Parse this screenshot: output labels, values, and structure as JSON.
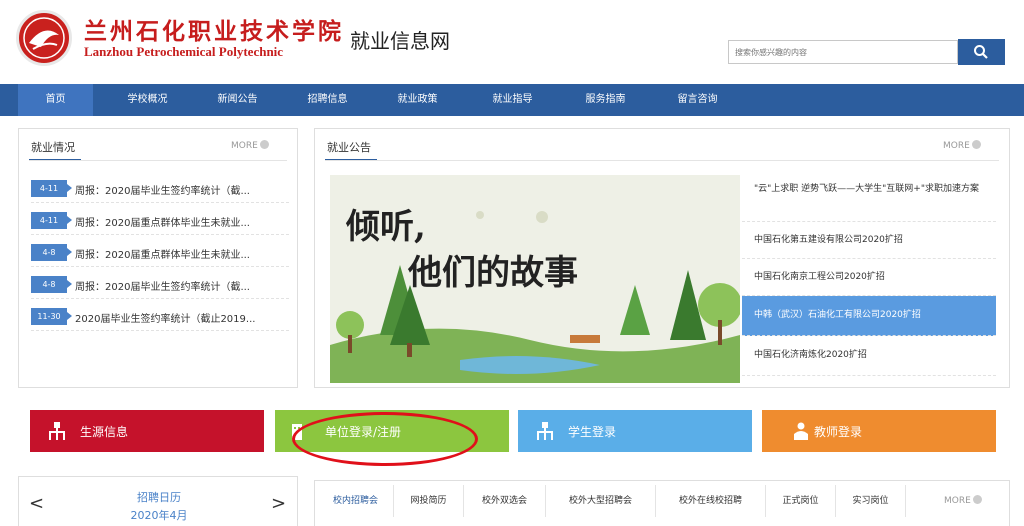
{
  "header": {
    "logo_cn": "兰州石化职业技术学院",
    "logo_en": "Lanzhou Petrochemical Polytechnic",
    "site_title": "就业信息网",
    "search_placeholder": "搜索你感兴趣的内容",
    "search_icon": "search-icon"
  },
  "nav": {
    "items": [
      "首页",
      "学校概况",
      "新闻公告",
      "招聘信息",
      "就业政策",
      "就业指导",
      "服务指南",
      "留言咨询"
    ],
    "active_index": 0
  },
  "employment": {
    "title": "就业情况",
    "more": "MORE",
    "items": [
      {
        "date": "4-11",
        "text": "周报：2020届毕业生签约率统计（截..."
      },
      {
        "date": "4-11",
        "text": "周报：2020届重点群体毕业生未就业..."
      },
      {
        "date": "4-8",
        "text": "周报：2020届重点群体毕业生未就业..."
      },
      {
        "date": "4-8",
        "text": "周报：2020届毕业生签约率统计（截..."
      },
      {
        "date": "11-30",
        "text": "2020届毕业生签约率统计（截止2019..."
      }
    ]
  },
  "announcements": {
    "title": "就业公告",
    "more": "MORE",
    "banner_line1": "倾听,",
    "banner_line2": "他们的故事",
    "items": [
      {
        "text": "\"云\"上求职 逆势飞跃——大学生\"互联网+\"求职加速方案"
      },
      {
        "text": "中国石化第五建设有限公司2020扩招"
      },
      {
        "text": "中国石化南京工程公司2020扩招"
      },
      {
        "text": "中韩（武汉）石油化工有限公司2020扩招",
        "highlighted": true
      },
      {
        "text": "中国石化济南炼化2020扩招"
      }
    ]
  },
  "quick_buttons": [
    {
      "label": "生源信息",
      "color": "#c5122b"
    },
    {
      "label": "单位登录/注册",
      "color": "#8cc63f"
    },
    {
      "label": "学生登录",
      "color": "#5aaee8"
    },
    {
      "label": "教师登录",
      "color": "#ef8c2f"
    }
  ],
  "calendar": {
    "title": "招聘日历",
    "month": "2020年4月",
    "prev": "<",
    "next": ">"
  },
  "tabs": {
    "items": [
      "校内招聘会",
      "网投简历",
      "校外双选会",
      "校外大型招聘会",
      "校外在线校招聘",
      "正式岗位",
      "实习岗位"
    ],
    "more": "MORE"
  },
  "colors": {
    "nav_bg": "#2c5d9e",
    "accent_red": "#c61d1d",
    "annotation": "#e0101a"
  }
}
